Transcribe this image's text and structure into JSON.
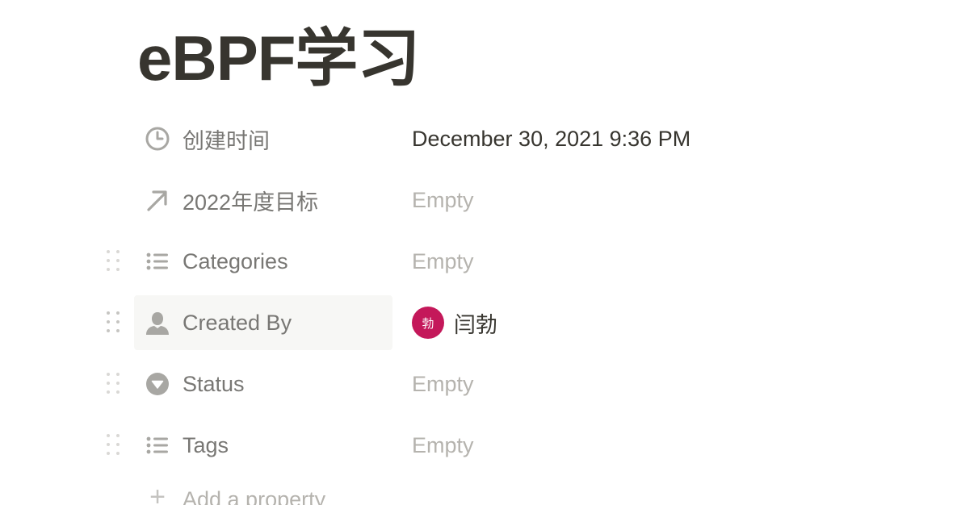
{
  "page": {
    "title": "eBPF学习"
  },
  "properties": [
    {
      "name": "创建时间",
      "icon": "clock-icon",
      "value": "December 30, 2021 9:36 PM"
    },
    {
      "name": "2022年度目标",
      "icon": "arrow-up-right-icon",
      "value": "Empty"
    },
    {
      "name": "Categories",
      "icon": "list-icon",
      "value": "Empty"
    },
    {
      "name": "Created By",
      "icon": "person-icon",
      "value": {
        "avatar_text": "勃",
        "name": "闫勃"
      }
    },
    {
      "name": "Status",
      "icon": "select-icon",
      "value": "Empty"
    },
    {
      "name": "Tags",
      "icon": "list-icon",
      "value": "Empty"
    }
  ],
  "add_property": {
    "label": "Add a property",
    "icon": "plus-icon"
  },
  "colors": {
    "avatar_bg": "#c4185a",
    "label_gray": "#787774",
    "empty_gray": "#b5b3ae",
    "text_dark": "#37352f"
  }
}
